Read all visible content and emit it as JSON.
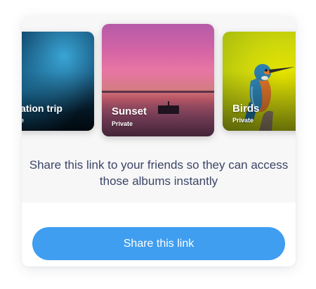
{
  "albums": [
    {
      "title": "ation trip",
      "visibility": "e"
    },
    {
      "title": "Sunset",
      "visibility": "Private"
    },
    {
      "title": "Birds",
      "visibility": "Private"
    }
  ],
  "message": "Share this link to your friends so they can access those albums instantly",
  "share_button": {
    "label": "Share this link"
  },
  "colors": {
    "accent": "#3f9ef0",
    "message_text": "#3b4565",
    "card_background": "#f7f7f8"
  }
}
